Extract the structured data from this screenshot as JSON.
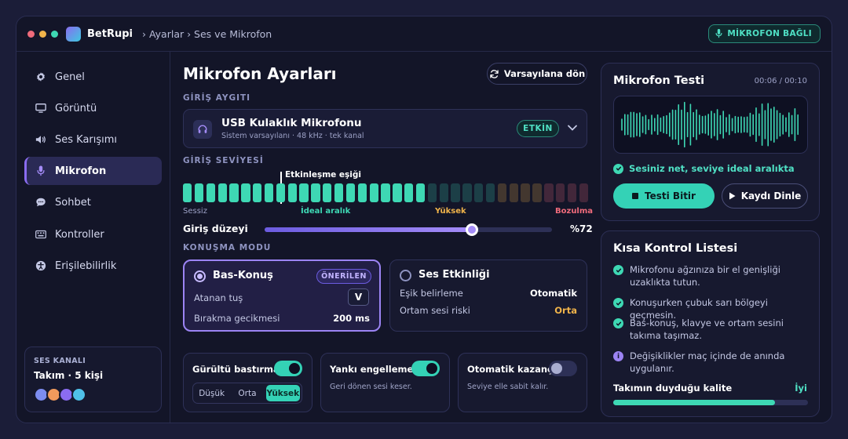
{
  "topbar": {
    "brand": "BetRupi",
    "breadcrumb": "› Ayarlar › Ses ve Mikrofon",
    "mic_status": "MİKROFON BAĞLI"
  },
  "sidebar": {
    "items": [
      {
        "label": "Genel",
        "icon": "gear-icon"
      },
      {
        "label": "Görüntü",
        "icon": "monitor-icon"
      },
      {
        "label": "Ses Karışımı",
        "icon": "speaker-icon"
      },
      {
        "label": "Mikrofon",
        "icon": "microphone-icon",
        "active": true
      },
      {
        "label": "Sohbet",
        "icon": "chat-icon"
      },
      {
        "label": "Kontroller",
        "icon": "keyboard-icon"
      },
      {
        "label": "Erişilebilirlik",
        "icon": "accessibility-icon"
      }
    ],
    "voice_channel": {
      "heading": "SES KANALI",
      "value": "Takım · 5 kişi",
      "avatar_colors": [
        "#7c8cf0",
        "#f09a5c",
        "#8a6cf0",
        "#4fc0e8"
      ]
    }
  },
  "main": {
    "title": "Mikrofon Ayarları",
    "reset_button": "Varsayılana dön",
    "input_device": {
      "section": "GİRİŞ AYGITI",
      "name": "USB Kulaklık Mikrofonu",
      "details": "Sistem varsayılanı · 48 kHz · tek kanal",
      "status": "ETKİN"
    },
    "input_level": {
      "section": "GİRİŞ SEVİYESİ",
      "threshold_label": "Etkinleşme eşiği",
      "zones": [
        {
          "label": "Sessiz",
          "color": "#9ca1c6"
        },
        {
          "label": "İdeal aralık",
          "color": "#3ed8b4"
        },
        {
          "label": "Yüksek",
          "color": "#f0b34a"
        },
        {
          "label": "Bozulma",
          "color": "#ef6b7b"
        }
      ],
      "active_segments": 21,
      "total_segments": 35,
      "gain_label": "Giriş düzeyi",
      "gain_value": "%72",
      "gain_fraction": 0.72
    },
    "speech_mode": {
      "section": "KONUŞMA MODU",
      "push_to_talk": {
        "title": "Bas-Konuş",
        "badge": "ÖNERİLEN",
        "selected": true,
        "key_label": "Atanan tuş",
        "key": "V",
        "delay_label": "Bırakma gecikmesi",
        "delay_value": "200 ms"
      },
      "voice_activity": {
        "title": "Ses Etkinliği",
        "selected": false,
        "threshold_label": "Eşik belirleme",
        "threshold_value": "Otomatik",
        "noise_label": "Ortam sesi riski",
        "noise_value": "Orta"
      }
    },
    "toggles": {
      "noise_suppression": {
        "label": "Gürültü bastırma",
        "on": true,
        "levels": [
          "Düşük",
          "Orta",
          "Yüksek"
        ],
        "selected_level": "Yüksek"
      },
      "echo_cancellation": {
        "label": "Yankı engelleme",
        "on": true,
        "description": "Geri dönen sesi keser."
      },
      "auto_gain": {
        "label": "Otomatik kazanç",
        "on": false,
        "description": "Seviye elle sabit kalır."
      }
    }
  },
  "mic_test": {
    "title": "Mikrofon Testi",
    "time": "00:06 / 00:10",
    "status": "Sesiniz net, seviye ideal aralıkta",
    "stop_button": "Testi Bitir",
    "play_button": "Kaydı Dinle"
  },
  "checklist": {
    "title": "Kısa Kontrol Listesi",
    "items": [
      {
        "text": "Mikrofonu ağzınıza bir el genişliği uzaklıkta tutun.",
        "icon": "check-icon"
      },
      {
        "text": "Konuşurken çubuk sarı bölgeyi geçmesin.",
        "icon": "check-icon"
      },
      {
        "text": "Bas-konuş, klavye ve ortam sesini takıma taşımaz.",
        "icon": "check-icon"
      },
      {
        "text": "Değişiklikler maç içinde de anında uygulanır.",
        "icon": "info-icon"
      }
    ],
    "quality_label": "Takımın duyduğu kalite",
    "quality_value": "İyi",
    "quality_fraction": 0.83
  },
  "colors": {
    "accent_teal": "#34d2b6",
    "accent_purple": "#9c84f4",
    "warning": "#f0b34a",
    "danger": "#ef6b7b"
  }
}
